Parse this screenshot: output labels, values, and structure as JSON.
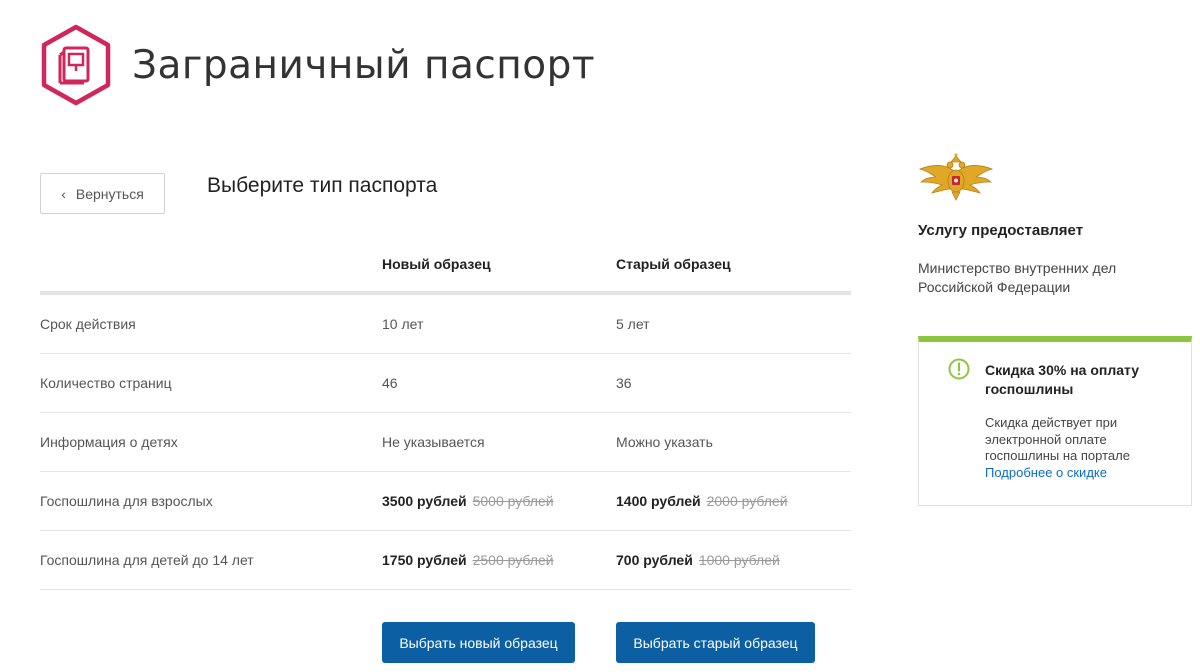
{
  "header": {
    "title": "Заграничный паспорт",
    "icon": "passport-icon",
    "accent_color": "#d0275a"
  },
  "nav": {
    "back_label": "Вернуться"
  },
  "section": {
    "title": "Выберите тип паспорта"
  },
  "table": {
    "columns": [
      "Новый образец",
      "Старый образец"
    ],
    "rows": [
      {
        "label": "Срок действия",
        "new": "10 лет",
        "old": "5 лет"
      },
      {
        "label": "Количество страниц",
        "new": "46",
        "old": "36"
      },
      {
        "label": "Информация о детях",
        "new": "Не указывается",
        "old": "Можно указать"
      },
      {
        "label": "Госпошлина для взрослых",
        "new_price": "3500 рублей",
        "new_old_price": "5000 рублей",
        "old_price": "1400 рублей",
        "old_old_price": "2000 рублей"
      },
      {
        "label": "Госпошлина для детей до 14 лет",
        "new_price": "1750 рублей",
        "new_old_price": "2500 рублей",
        "old_price": "700 рублей",
        "old_old_price": "1000 рублей"
      }
    ]
  },
  "actions": {
    "select_new": "Выбрать новый образец",
    "select_old": "Выбрать старый образец",
    "button_color": "#0d5fa3"
  },
  "provider": {
    "emblem": "double-headed-eagle-emblem",
    "title": "Услугу предоставляет",
    "name": "Министерство внутренних дел Российской Федерации"
  },
  "discount": {
    "title": "Скидка 30% на оплату госпошлины",
    "text": "Скидка действует при электронной оплате госпошлины на портале",
    "link": "Подробнее о скидке",
    "accent_color": "#8cc63f",
    "icon": "alert-circle-icon"
  }
}
